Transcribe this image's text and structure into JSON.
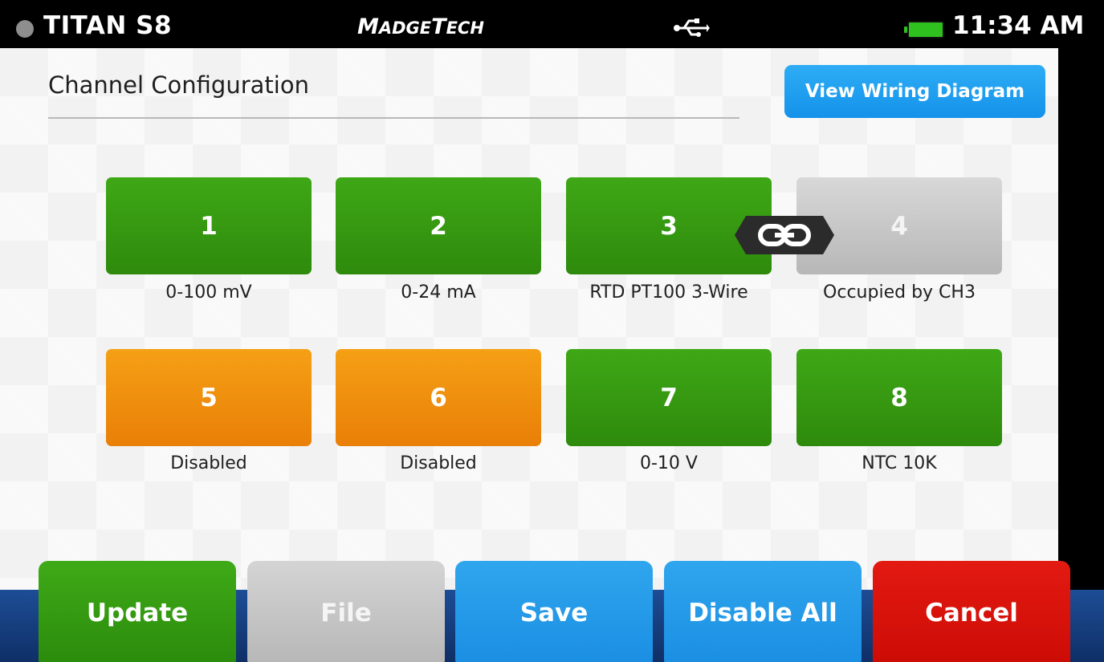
{
  "status_bar": {
    "device_name": "TITAN S8",
    "brand_first_letter": "M",
    "brand_rest_1": "ADGE",
    "brand_mid_letter": "T",
    "brand_rest_2": "ECH",
    "time": "11:34 AM",
    "icons": [
      "record-dot-icon",
      "usb-icon",
      "battery-icon"
    ],
    "battery_color": "#2fc21f"
  },
  "page": {
    "title": "Channel Configuration",
    "wiring_button_label": "View Wiring Diagram"
  },
  "channels": [
    {
      "number": "1",
      "label": "0-100 mV",
      "state": "enabled",
      "color": "#3fa816"
    },
    {
      "number": "2",
      "label": "0-24 mA",
      "state": "enabled",
      "color": "#3fa816"
    },
    {
      "number": "3",
      "label": "RTD PT100 3-Wire",
      "state": "enabled",
      "color": "#3fa816"
    },
    {
      "number": "4",
      "label": "Occupied by CH3",
      "state": "occupied",
      "color": "#c8c8c8"
    },
    {
      "number": "5",
      "label": "Disabled",
      "state": "disabled",
      "color": "#f5a015"
    },
    {
      "number": "6",
      "label": "Disabled",
      "state": "disabled",
      "color": "#f5a015"
    },
    {
      "number": "7",
      "label": "0-10 V",
      "state": "enabled",
      "color": "#3fa816"
    },
    {
      "number": "8",
      "label": "NTC 10K",
      "state": "enabled",
      "color": "#3fa816"
    }
  ],
  "link": {
    "icon": "chain-link-icon",
    "from": "3",
    "to": "4"
  },
  "actions": {
    "update": "Update",
    "file": "File",
    "save": "Save",
    "disable_all": "Disable All",
    "cancel": "Cancel"
  }
}
